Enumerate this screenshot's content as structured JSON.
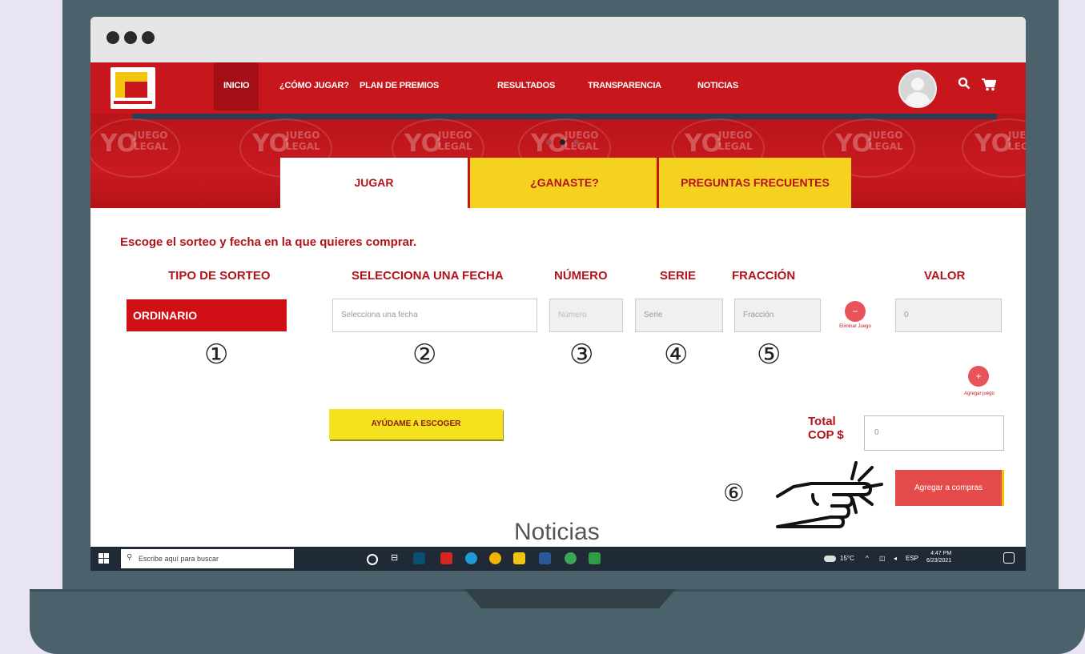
{
  "nav": {
    "items": [
      "INICIO",
      "¿CÓMO JUGAR?",
      "PLAN DE PREMIOS",
      "RESULTADOS",
      "TRANSPARENCIA",
      "NOTICIAS"
    ],
    "search_icon": "search-icon",
    "cart_icon": "cart-icon"
  },
  "banner": {
    "mark_yo": "YO",
    "mark_juego": "JUEGO",
    "mark_legal": "LEGAL"
  },
  "tabs": {
    "jugar": "JUGAR",
    "ganaste": "¿GANASTE?",
    "preguntas": "PREGUNTAS FRECUENTES"
  },
  "form": {
    "instruction": "Escoge el sorteo y fecha en la que quieres comprar.",
    "headers": {
      "tipo": "TIPO DE SORTEO",
      "fecha": "SELECCIONA UNA FECHA",
      "numero": "NÚMERO",
      "serie": "SERIE",
      "fraccion": "FRACCIÓN",
      "valor": "VALOR"
    },
    "tipo_value": "ORDINARIO",
    "fecha_placeholder": "Selecciona una fecha",
    "numero_placeholder": "Número",
    "serie_placeholder": "Serie",
    "fraccion_placeholder": "Fracción",
    "valor_value": "0",
    "eliminar_label": "Eliminar Juego",
    "agregar_juego_label": "Agregar juego",
    "help_button": "AYÚDAME A ESCOGER",
    "total_label_line1": "Total",
    "total_label_line2": "COP $",
    "total_value": "0",
    "agregar_compras": "Agregar a compras"
  },
  "steps": [
    "①",
    "②",
    "③",
    "④",
    "⑤",
    "⑥"
  ],
  "noticias_heading": "Noticias",
  "taskbar": {
    "search_placeholder": "Escribe aquí para buscar",
    "temperature": "15°C",
    "language": "ESP",
    "time": "4:47 PM",
    "date": "6/23/2021"
  }
}
